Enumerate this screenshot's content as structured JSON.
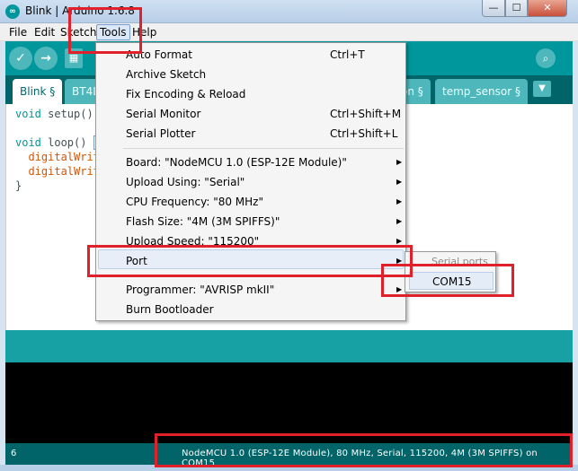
{
  "window": {
    "title": "Blink | Arduino 1.6.8",
    "min": "—",
    "max": "☐",
    "close": "✕",
    "app_icon": "∞"
  },
  "menubar": {
    "items": [
      "File",
      "Edit",
      "Sketch",
      "Tools",
      "Help"
    ]
  },
  "toolbar": {
    "verify_icon": "✓",
    "upload_icon": "→",
    "new_icon": "▦",
    "open_icon": "↑",
    "save_icon": "↓",
    "serial_icon": "⌕"
  },
  "tabs": [
    {
      "label": "Blink §"
    },
    {
      "label": "BT4L"
    },
    {
      "label": "on §"
    },
    {
      "label": "temp_sensor §"
    }
  ],
  "tab_dropdown": "▼",
  "code": {
    "l1a": "void",
    "l1b": " setup()",
    "l3a": "void",
    "l3b": " loop() ",
    "l3c": "{",
    "l4": "  digitalWrit",
    "l5": "  digitalWrit",
    "l6": "}"
  },
  "tools_menu": {
    "items": [
      {
        "label": "Auto Format",
        "shortcut": "Ctrl+T"
      },
      {
        "label": "Archive Sketch",
        "shortcut": ""
      },
      {
        "label": "Fix Encoding & Reload",
        "shortcut": ""
      },
      {
        "label": "Serial Monitor",
        "shortcut": "Ctrl+Shift+M"
      },
      {
        "label": "Serial Plotter",
        "shortcut": "Ctrl+Shift+L"
      },
      {
        "label": "Board: \"NodeMCU 1.0 (ESP-12E Module)\"",
        "shortcut": ""
      },
      {
        "label": "Upload Using: \"Serial\"",
        "shortcut": ""
      },
      {
        "label": "CPU Frequency: \"80 MHz\"",
        "shortcut": ""
      },
      {
        "label": "Flash Size: \"4M (3M SPIFFS)\"",
        "shortcut": ""
      },
      {
        "label": "Upload Speed: \"115200\"",
        "shortcut": ""
      },
      {
        "label": "Port",
        "shortcut": ""
      },
      {
        "label": "Programmer: \"AVRISP mkII\"",
        "shortcut": ""
      },
      {
        "label": "Burn Bootloader",
        "shortcut": ""
      }
    ],
    "arrow": "▶"
  },
  "port_submenu": {
    "header": "Serial ports",
    "item": "COM15"
  },
  "status": {
    "line": "6",
    "board": "NodeMCU 1.0 (ESP-12E Module), 80 MHz, Serial, 115200, 4M (3M SPIFFS) on COM15"
  },
  "colors": {
    "teal": "#00979c",
    "dark_teal": "#006468",
    "annotation_red": "#e0202a"
  }
}
